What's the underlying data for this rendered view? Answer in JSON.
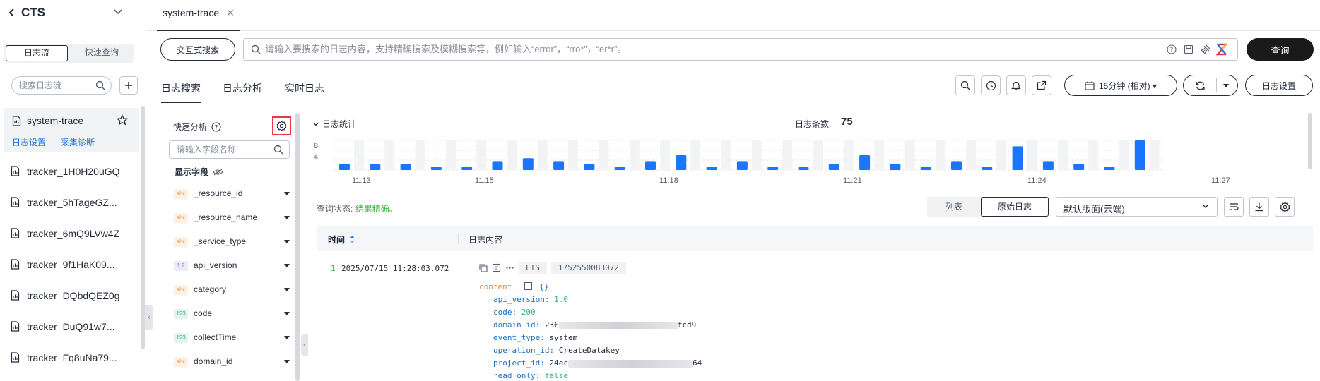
{
  "app": {
    "title": "CTS"
  },
  "sidebar": {
    "segments": [
      "日志流",
      "快速查询"
    ],
    "search_placeholder": "搜索日志流",
    "active_stream": {
      "name": "system-trace",
      "links": [
        "日志设置",
        "采集诊断"
      ]
    },
    "streams": [
      "tracker_1H0H20uGQ",
      "tracker_5hTageGZ...",
      "tracker_6mQ9LVw4Z",
      "tracker_9f1HaK09...",
      "tracker_DQbdQEZ0g",
      "tracker_DuQ91w7...",
      "tracker_Fq8uNa79..."
    ]
  },
  "tabs": [
    {
      "label": "system-trace",
      "close": "✕"
    }
  ],
  "query": {
    "interactive_button": "交互式搜索",
    "placeholder": "请输入要搜索的日志内容，支持精确搜索及模糊搜索等，例如输入“error”，“rro*”，“er*r”。",
    "submit": "查询"
  },
  "subtabs": [
    "日志搜索",
    "日志分析",
    "实时日志"
  ],
  "toolbar": {
    "time_range": "15分钟 (相对) ▾",
    "log_settings": "日志设置"
  },
  "quick_analysis": {
    "title": "快速分析",
    "search_placeholder": "请输入字段名称",
    "show_fields": "显示字段",
    "fields": [
      {
        "type": "abc",
        "name": "_resource_id"
      },
      {
        "type": "abc",
        "name": "_resource_name"
      },
      {
        "type": "abc",
        "name": "_service_type"
      },
      {
        "type": "1.2",
        "name": "api_version"
      },
      {
        "type": "abc",
        "name": "category"
      },
      {
        "type": "123",
        "name": "code"
      },
      {
        "type": "123",
        "name": "collectTime"
      },
      {
        "type": "abc",
        "name": "domain_id"
      }
    ]
  },
  "stats": {
    "title": "日志统计",
    "count_label": "日志条数:",
    "count": "75",
    "query_status_label": "查询状态:",
    "query_status": "结果精确。"
  },
  "chart_data": {
    "type": "bar",
    "title": "",
    "y_ticks": [
      "8",
      "4"
    ],
    "x_ticks": [
      "11:13",
      "11:15",
      "11:18",
      "11:21",
      "11:24",
      "11:27"
    ],
    "ylim": [
      0,
      10
    ],
    "values": [
      2,
      2,
      2,
      1,
      1,
      3,
      4,
      3,
      2,
      1,
      3,
      5,
      1,
      3,
      1,
      1,
      2,
      5,
      2,
      1,
      3,
      1,
      8,
      3,
      2,
      1,
      10
    ]
  },
  "view": {
    "options": [
      "列表",
      "原始日志"
    ],
    "layout": "默认版面(云端)"
  },
  "table": {
    "col_time": "时间",
    "col_content": "日志内容",
    "row": {
      "index": "1",
      "time": "2025/07/15 11:28:03.072",
      "chips": [
        "LTS",
        "1752550083072"
      ],
      "content_key": "content:",
      "content_brace": "{}",
      "fields": [
        {
          "k": "api_version:",
          "v": "1.0",
          "t": "num"
        },
        {
          "k": "code:",
          "v": "200",
          "t": "num"
        },
        {
          "k": "domain_id:",
          "v_pre": "23€",
          "v_post": "fcd9",
          "t": "redact"
        },
        {
          "k": "event_type:",
          "v": "system",
          "t": "str"
        },
        {
          "k": "operation_id:",
          "v": "CreateDatakey",
          "t": "str"
        },
        {
          "k": "project_id:",
          "v_pre": "24ec",
          "v_post": "64",
          "t": "redact"
        },
        {
          "k": "read_only:",
          "v": "false",
          "t": "bool"
        }
      ]
    }
  },
  "colors": {
    "accent": "#1a76ff",
    "dark": "#1a1a1a",
    "highlight": "#e63946"
  }
}
